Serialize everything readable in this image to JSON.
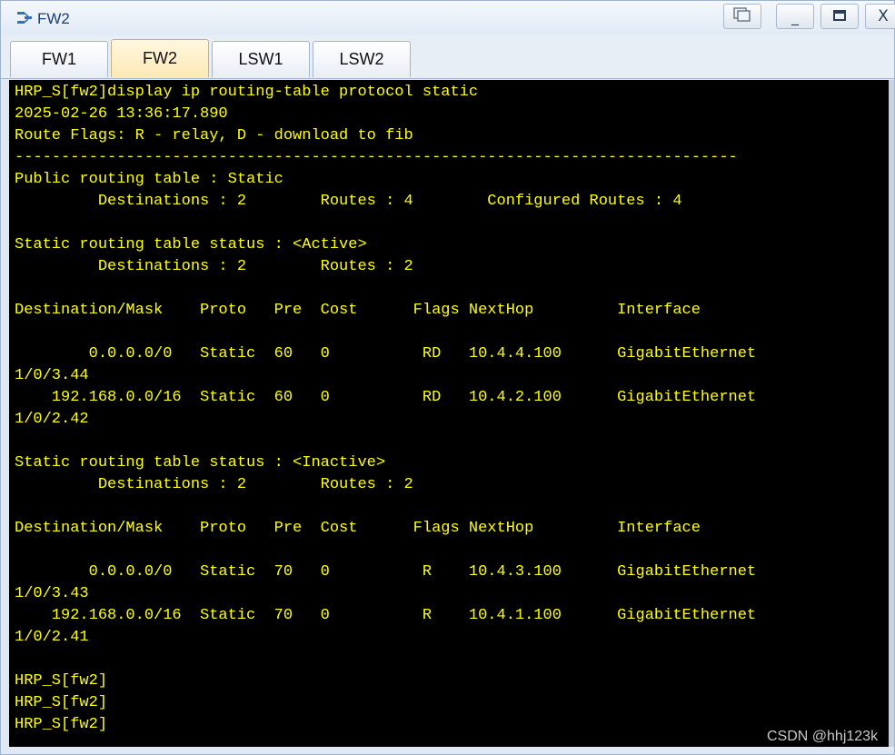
{
  "window": {
    "title": "FW2"
  },
  "tabs": [
    {
      "label": "FW1",
      "active": false
    },
    {
      "label": "FW2",
      "active": true
    },
    {
      "label": "LSW1",
      "active": false
    },
    {
      "label": "LSW2",
      "active": false
    }
  ],
  "window_buttons": {
    "minimize": "_",
    "close": "X"
  },
  "terminal": {
    "lines": [
      "HRP_S[fw2]display ip routing-table protocol static",
      "2025-02-26 13:36:17.890",
      "Route Flags: R - relay, D - download to fib",
      "------------------------------------------------------------------------------",
      "Public routing table : Static",
      "         Destinations : 2        Routes : 4        Configured Routes : 4",
      "",
      "Static routing table status : <Active>",
      "         Destinations : 2        Routes : 2",
      "",
      "Destination/Mask    Proto   Pre  Cost      Flags NextHop         Interface",
      "",
      "        0.0.0.0/0   Static  60   0          RD   10.4.4.100      GigabitEthernet",
      "1/0/3.44",
      "    192.168.0.0/16  Static  60   0          RD   10.4.2.100      GigabitEthernet",
      "1/0/2.42",
      "",
      "Static routing table status : <Inactive>",
      "         Destinations : 2        Routes : 2",
      "",
      "Destination/Mask    Proto   Pre  Cost      Flags NextHop         Interface",
      "",
      "        0.0.0.0/0   Static  70   0          R    10.4.3.100      GigabitEthernet",
      "1/0/3.43",
      "    192.168.0.0/16  Static  70   0          R    10.4.1.100      GigabitEthernet",
      "1/0/2.41",
      "",
      "HRP_S[fw2]",
      "HRP_S[fw2]",
      "HRP_S[fw2]"
    ]
  },
  "watermark": "CSDN @hhj123k",
  "colors": {
    "terminal_bg": "#000000",
    "terminal_text": "#ffff00",
    "title_text": "#1d3f72",
    "active_tab": "#fde9b8"
  }
}
